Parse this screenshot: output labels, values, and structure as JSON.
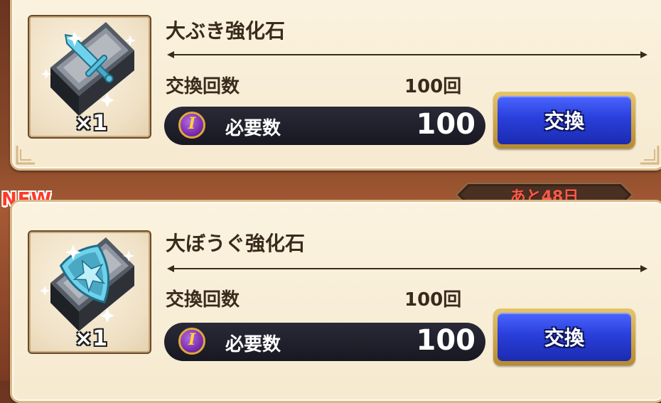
{
  "items": [
    {
      "name": "大ぶき強化石",
      "icon": "sword-stone-icon",
      "quantity": "×1",
      "exchange_count_label": "交換回数",
      "exchange_count_value": "100回",
      "required_label": "必要数",
      "required_value": "100",
      "coin_letter": "I",
      "button_label": "交換"
    },
    {
      "name": "大ぼうぐ強化石",
      "icon": "shield-stone-icon",
      "quantity": "×1",
      "exchange_count_label": "交換回数",
      "exchange_count_value": "100回",
      "required_label": "必要数",
      "required_value": "100",
      "coin_letter": "I",
      "button_label": "交換",
      "badge": "NEW",
      "time_remaining": "あと48日"
    }
  ],
  "colors": {
    "button_blue": "#2a3fdc",
    "button_gold": "#e6c56a",
    "new_badge": "#ff3a2a",
    "timer_text": "#ff5a4a",
    "card_bg": "#f6ead0"
  }
}
